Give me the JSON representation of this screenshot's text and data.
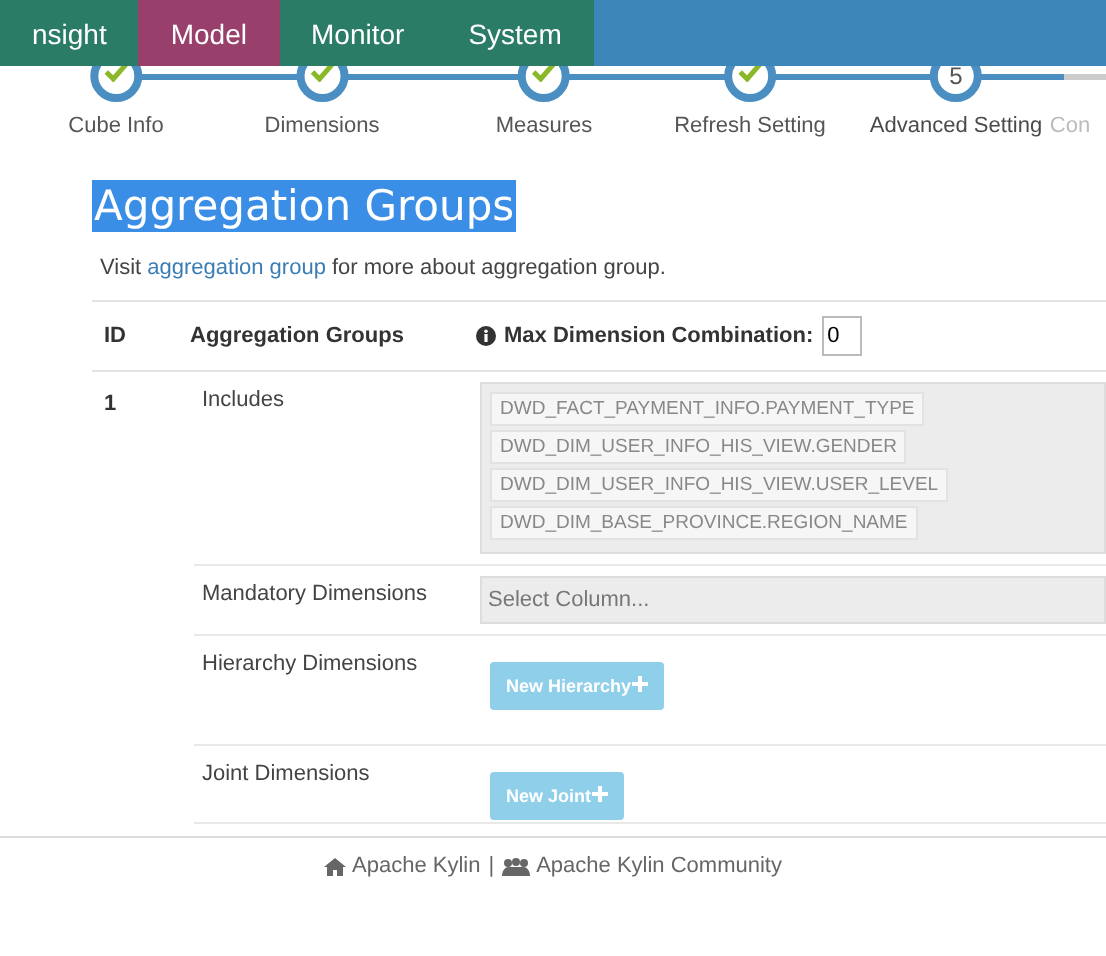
{
  "nav": {
    "tabs": [
      {
        "label": "nsight",
        "selected": false
      },
      {
        "label": "Model",
        "selected": true
      },
      {
        "label": "Monitor",
        "selected": false
      },
      {
        "label": "System",
        "selected": false
      }
    ]
  },
  "steps": [
    {
      "label": "Cube Info",
      "completed": true,
      "active": false
    },
    {
      "label": "Dimensions",
      "completed": true,
      "active": false
    },
    {
      "label": "Measures",
      "completed": true,
      "active": false
    },
    {
      "label": "Refresh Setting",
      "completed": true,
      "active": false
    },
    {
      "label": "Advanced Setting",
      "completed": false,
      "active": true,
      "number": "5"
    },
    {
      "label": "Con",
      "completed": false,
      "active": false
    }
  ],
  "section": {
    "title": "Aggregation Groups",
    "intro_before": "Visit ",
    "intro_link": "aggregation group",
    "intro_after": " for more about aggregation group."
  },
  "table": {
    "columns": [
      "ID",
      "Aggregation Groups"
    ],
    "max_label": "Max Dimension Combination:",
    "max_value": "0",
    "rows": [
      {
        "id": "1",
        "includes_label": "Includes",
        "includes": [
          "DWD_FACT_PAYMENT_INFO.PAYMENT_TYPE",
          "DWD_DIM_USER_INFO_HIS_VIEW.GENDER",
          "DWD_DIM_USER_INFO_HIS_VIEW.USER_LEVEL",
          "DWD_DIM_BASE_PROVINCE.REGION_NAME"
        ],
        "mandatory_label": "Mandatory Dimensions",
        "mandatory_placeholder": "Select Column...",
        "hierarchy_label": "Hierarchy Dimensions",
        "hierarchy_button": "New Hierarchy",
        "joint_label": "Joint Dimensions",
        "joint_button": "New Joint"
      }
    ]
  },
  "footer": {
    "home_link": "Apache Kylin",
    "separator": "|",
    "community_link": "Apache Kylin Community"
  }
}
